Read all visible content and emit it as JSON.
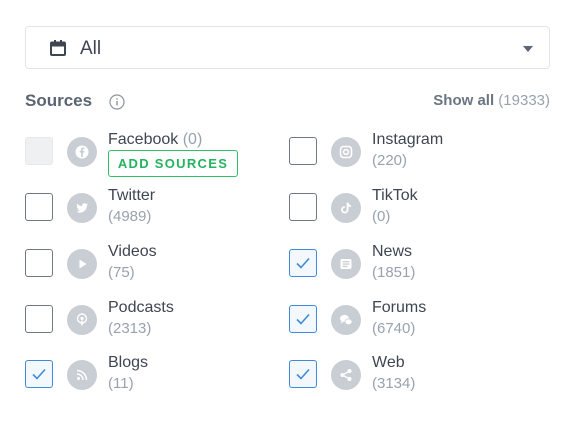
{
  "filter": {
    "value": "All"
  },
  "sources": {
    "heading": "Sources",
    "show_all_label": "Show all",
    "show_all_count": "(19333)",
    "add_sources_label": "ADD SOURCES",
    "items": [
      {
        "name": "Facebook",
        "count": "(0)",
        "checked": false,
        "disabled": true,
        "icon": "facebook-icon"
      },
      {
        "name": "Instagram",
        "count": "(220)",
        "checked": false,
        "icon": "instagram-icon"
      },
      {
        "name": "Twitter",
        "count": "(4989)",
        "checked": false,
        "icon": "twitter-icon"
      },
      {
        "name": "TikTok",
        "count": "(0)",
        "checked": false,
        "icon": "tiktok-icon"
      },
      {
        "name": "Videos",
        "count": "(75)",
        "checked": false,
        "icon": "play-icon"
      },
      {
        "name": "News",
        "count": "(1851)",
        "checked": true,
        "icon": "news-icon"
      },
      {
        "name": "Podcasts",
        "count": "(2313)",
        "checked": false,
        "icon": "podcast-icon"
      },
      {
        "name": "Forums",
        "count": "(6740)",
        "checked": true,
        "icon": "forums-icon"
      },
      {
        "name": "Blogs",
        "count": "(11)",
        "checked": true,
        "icon": "rss-icon"
      },
      {
        "name": "Web",
        "count": "(3134)",
        "checked": true,
        "icon": "share-icon"
      }
    ]
  },
  "colors": {
    "check_border": "#3f8bd9",
    "add_button": "#2fbf6a",
    "icon_circle": "#c9ced4"
  }
}
